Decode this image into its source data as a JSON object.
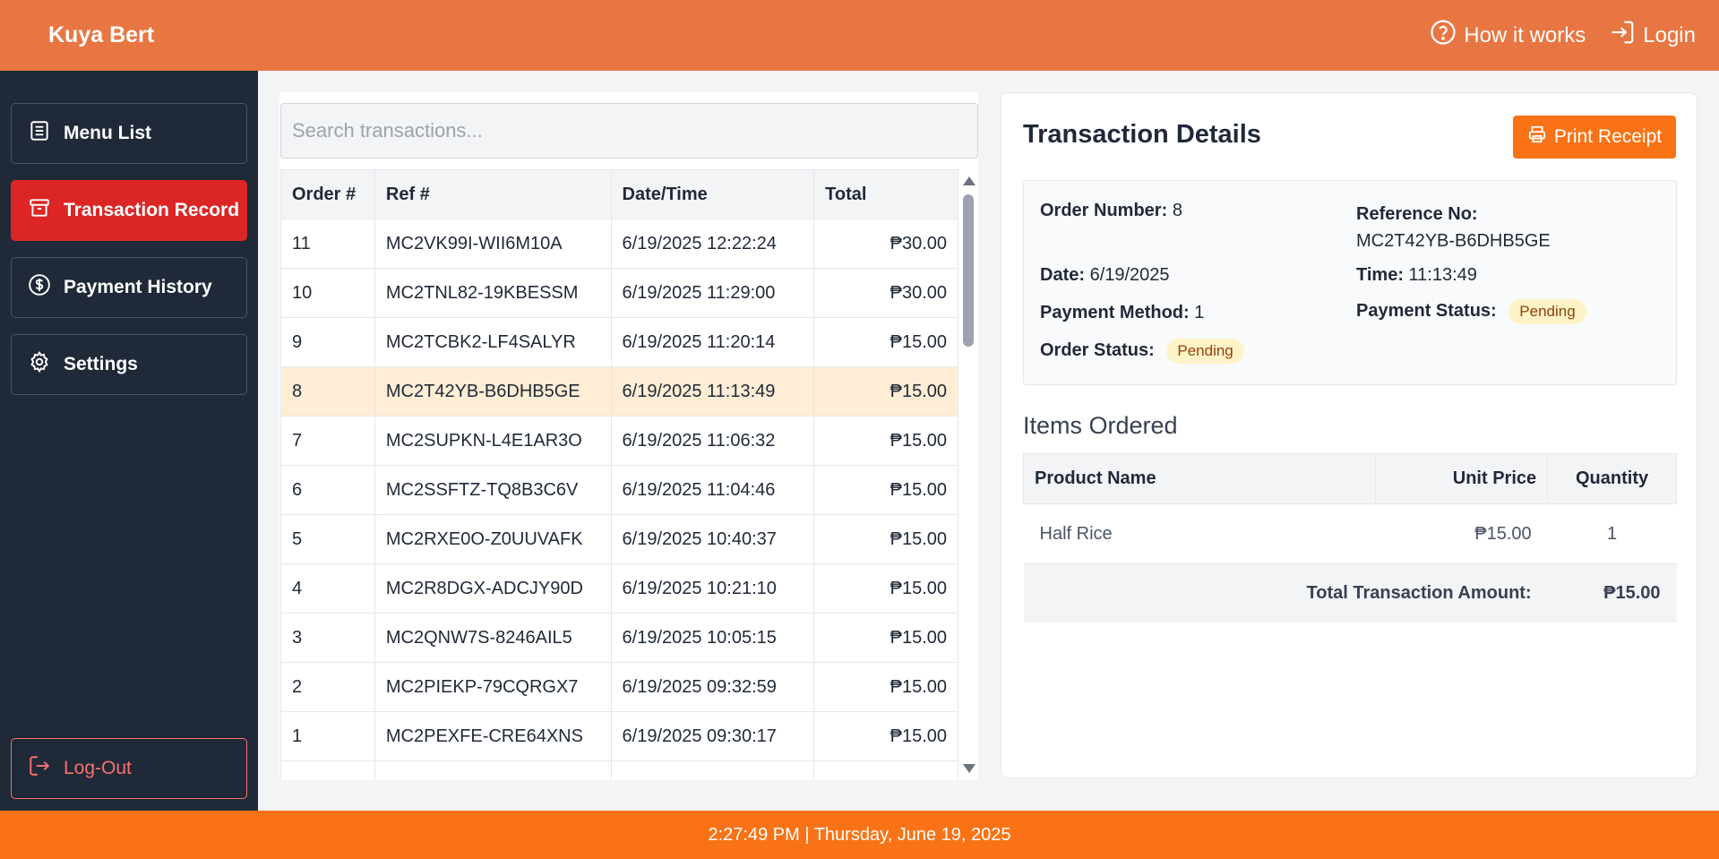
{
  "header": {
    "brand": "Kuya Bert",
    "how_it_works": "How it works",
    "login": "Login"
  },
  "sidebar": {
    "items": [
      {
        "label": "Menu List",
        "icon": "list-icon"
      },
      {
        "label": "Transaction Record",
        "icon": "archive-icon",
        "active": true
      },
      {
        "label": "Payment History",
        "icon": "dollar-circle-icon"
      },
      {
        "label": "Settings",
        "icon": "gear-icon"
      }
    ],
    "logout": "Log-Out"
  },
  "search": {
    "placeholder": "Search transactions..."
  },
  "transactions": {
    "columns": [
      "Order #",
      "Ref #",
      "Date/Time",
      "Total"
    ],
    "rows": [
      {
        "order": "11",
        "ref": "MC2VK99I-WII6M10A",
        "datetime": "6/19/2025 12:22:24",
        "total": "₱30.00"
      },
      {
        "order": "10",
        "ref": "MC2TNL82-19KBESSM",
        "datetime": "6/19/2025 11:29:00",
        "total": "₱30.00"
      },
      {
        "order": "9",
        "ref": "MC2TCBK2-LF4SALYR",
        "datetime": "6/19/2025 11:20:14",
        "total": "₱15.00"
      },
      {
        "order": "8",
        "ref": "MC2T42YB-B6DHB5GE",
        "datetime": "6/19/2025 11:13:49",
        "total": "₱15.00",
        "selected": true
      },
      {
        "order": "7",
        "ref": "MC2SUPKN-L4E1AR3O",
        "datetime": "6/19/2025 11:06:32",
        "total": "₱15.00"
      },
      {
        "order": "6",
        "ref": "MC2SSFTZ-TQ8B3C6V",
        "datetime": "6/19/2025 11:04:46",
        "total": "₱15.00"
      },
      {
        "order": "5",
        "ref": "MC2RXE0O-Z0UUVAFK",
        "datetime": "6/19/2025 10:40:37",
        "total": "₱15.00"
      },
      {
        "order": "4",
        "ref": "MC2R8DGX-ADCJY90D",
        "datetime": "6/19/2025 10:21:10",
        "total": "₱15.00"
      },
      {
        "order": "3",
        "ref": "MC2QNW7S-8246AIL5",
        "datetime": "6/19/2025 10:05:15",
        "total": "₱15.00"
      },
      {
        "order": "2",
        "ref": "MC2PIEKP-79CQRGX7",
        "datetime": "6/19/2025 09:32:59",
        "total": "₱15.00"
      },
      {
        "order": "1",
        "ref": "MC2PEXFE-CRE64XNS",
        "datetime": "6/19/2025 09:30:17",
        "total": "₱15.00"
      }
    ]
  },
  "details": {
    "title": "Transaction Details",
    "print_label": "Print Receipt",
    "order_number_label": "Order Number:",
    "order_number": "8",
    "reference_label": "Reference No:",
    "reference": "MC2T42YB-B6DHB5GE",
    "date_label": "Date:",
    "date": "6/19/2025",
    "time_label": "Time:",
    "time": "11:13:49",
    "payment_method_label": "Payment Method:",
    "payment_method": "1",
    "payment_status_label": "Payment Status:",
    "payment_status": "Pending",
    "order_status_label": "Order Status:",
    "order_status": "Pending",
    "items_title": "Items Ordered",
    "items_columns": [
      "Product Name",
      "Unit Price",
      "Quantity"
    ],
    "items": [
      {
        "name": "Half Rice",
        "price": "₱15.00",
        "qty": "1"
      }
    ],
    "total_label": "Total Transaction Amount:",
    "total": "₱15.00"
  },
  "footer": {
    "datetime": "2:27:49 PM | Thursday, June 19, 2025"
  },
  "colors": {
    "header": "#e87642",
    "sidebar": "#1f2937",
    "active": "#dc2626",
    "accent": "#f97316",
    "selected_row": "#ffedd5",
    "badge": "#fef3c7"
  }
}
